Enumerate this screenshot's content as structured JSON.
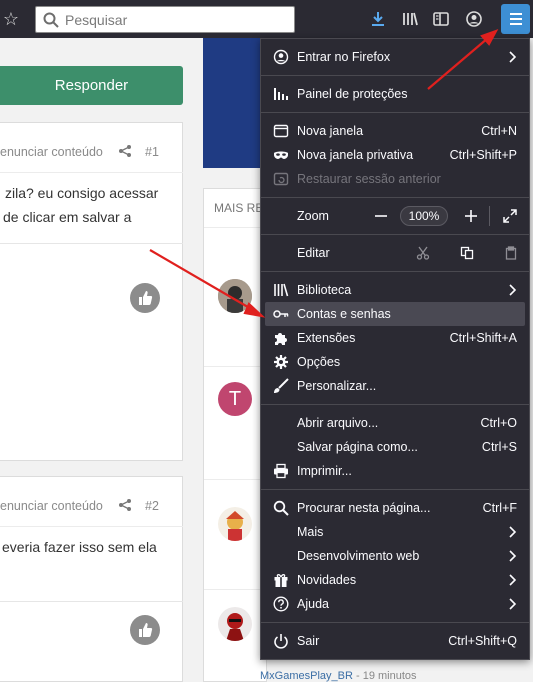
{
  "toolbar": {
    "search_placeholder": "Pesquisar",
    "accent_color": "#3d8fd4"
  },
  "page": {
    "reply_label": "Responder",
    "posts": [
      {
        "report": "enunciar conteúdo",
        "num": "#1",
        "lines": [
          "zila? eu consigo acessar",
          "de clicar em salvar a"
        ]
      },
      {
        "report": "enunciar conteúdo",
        "num": "#2",
        "lines": [
          "everia fazer isso sem ela"
        ]
      }
    ],
    "side_title": "MAIS RE",
    "avatar_letter": "T",
    "footer_user": "MxGamesPlay_BR",
    "footer_time": " - 19 minutos"
  },
  "menu": {
    "signin": "Entrar no Firefox",
    "protections": "Painel de proteções",
    "new_window": "Nova janela",
    "new_window_sc": "Ctrl+N",
    "private_window": "Nova janela privativa",
    "private_window_sc": "Ctrl+Shift+P",
    "restore": "Restaurar sessão anterior",
    "zoom": "Zoom",
    "zoom_value": "100%",
    "edit": "Editar",
    "library": "Biblioteca",
    "logins": "Contas e senhas",
    "addons": "Extensões",
    "addons_sc": "Ctrl+Shift+A",
    "options": "Opções",
    "customize": "Personalizar...",
    "open_file": "Abrir arquivo...",
    "open_file_sc": "Ctrl+O",
    "save_page": "Salvar página como...",
    "save_page_sc": "Ctrl+S",
    "print": "Imprimir...",
    "find": "Procurar nesta página...",
    "find_sc": "Ctrl+F",
    "more": "Mais",
    "webdev": "Desenvolvimento web",
    "whatsnew": "Novidades",
    "help": "Ajuda",
    "quit": "Sair",
    "quit_sc": "Ctrl+Shift+Q"
  },
  "colors": {
    "menu_bg": "#2b2a33",
    "highlight": "#4a4953",
    "reply_green": "#3d8f6b",
    "annotation_red": "#e0201e"
  }
}
